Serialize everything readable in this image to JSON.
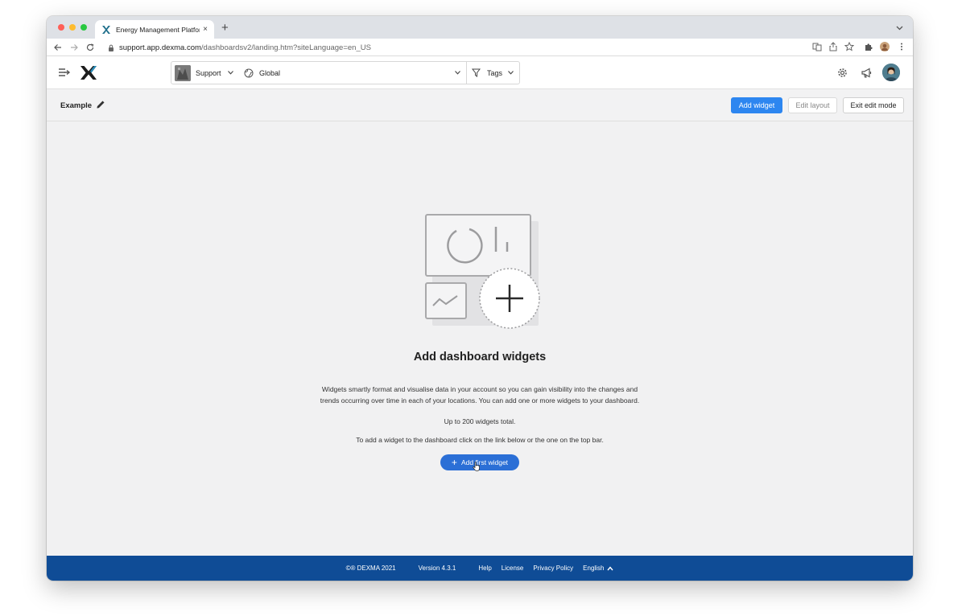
{
  "browser": {
    "tab_title": "Energy Management Platform",
    "tab_close": "×",
    "new_tab": "+",
    "url_host": "support.app.dexma.com",
    "url_path": "/dashboardsv2/landing.htm?siteLanguage=en_US"
  },
  "header": {
    "account": "Support",
    "location": "Global",
    "tags": "Tags"
  },
  "toolbar": {
    "dashboard_title": "Example",
    "add_widget": "Add widget",
    "edit_layout": "Edit layout",
    "exit_edit": "Exit edit mode"
  },
  "empty_state": {
    "title": "Add dashboard widgets",
    "description": "Widgets smartly format and visualise data in your account so you can gain visibility into the changes and trends occurring over time in each of your locations. You can add one or more widgets to your dashboard.",
    "limit": "Up to 200 widgets total.",
    "hint": "To add a widget to the dashboard click on the link below or the one on the top bar.",
    "button_plus": "+",
    "button_label": "Add first widget"
  },
  "footer": {
    "copyright": "©® DEXMA 2021",
    "version": "Version 4.3.1",
    "help": "Help",
    "license": "License",
    "privacy": "Privacy Policy",
    "language": "English"
  },
  "colors": {
    "primary": "#2d86f0",
    "footer": "#0f4c96"
  }
}
